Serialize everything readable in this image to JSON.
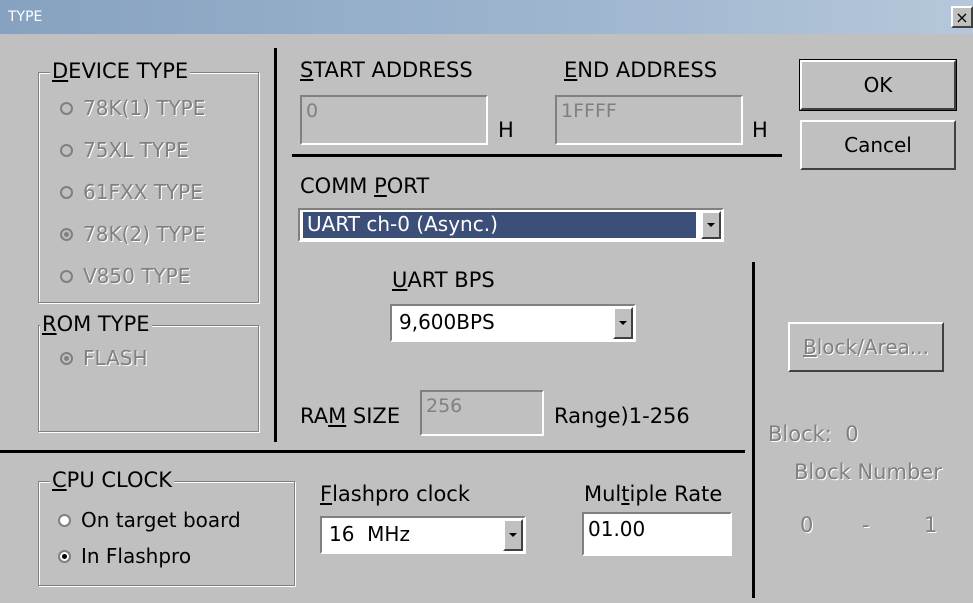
{
  "window": {
    "title": "TYPE",
    "close_glyph": "×"
  },
  "device_type": {
    "label_hotkey": "D",
    "label_rest": "EVICE TYPE",
    "options": [
      {
        "label": "78K(1) TYPE",
        "selected": false
      },
      {
        "label": "75XL TYPE",
        "selected": false
      },
      {
        "label": "61FXX TYPE",
        "selected": false
      },
      {
        "label": "78K(2) TYPE",
        "selected": true
      },
      {
        "label": "V850 TYPE",
        "selected": false
      }
    ]
  },
  "rom_type": {
    "label_hotkey": "R",
    "label_rest": "OM TYPE",
    "options": [
      {
        "label": "FLASH",
        "selected": true
      }
    ]
  },
  "start_address": {
    "label_hotkey": "S",
    "label_rest": "TART ADDRESS",
    "value": "0",
    "suffix": "H"
  },
  "end_address": {
    "label_hotkey": "E",
    "label_rest": "ND ADDRESS",
    "value": "1FFFF",
    "suffix": "H"
  },
  "buttons": {
    "ok": "OK",
    "cancel": "Cancel",
    "block_area_hotkey": "B",
    "block_area_rest": "lock/Area..."
  },
  "comm_port": {
    "label_pre": "COMM ",
    "label_hotkey": "P",
    "label_rest": "ORT",
    "value": "UART ch-0 (Async.)"
  },
  "uart_bps": {
    "label_hotkey": "U",
    "label_rest": "ART BPS",
    "value": "9,600BPS"
  },
  "ram_size": {
    "label_pre": "RA",
    "label_hotkey": "M",
    "label_rest": " SIZE",
    "value": "256",
    "range": "Range)1-256"
  },
  "block": {
    "label": "Block:",
    "value": "0",
    "number_label": "Block Number",
    "from": "0",
    "dash": "-",
    "to": "1"
  },
  "cpu_clock": {
    "label_hotkey": "C",
    "label_rest": "PU CLOCK",
    "options": [
      {
        "label": "On target board",
        "selected": false
      },
      {
        "label": "In Flashpro",
        "selected": true
      }
    ]
  },
  "flashpro_clock": {
    "label_hotkey": "F",
    "label_rest": "lashpro clock",
    "value": "16  MHz"
  },
  "multiple_rate": {
    "label_pre": "Mul",
    "label_hotkey": "t",
    "label_rest": "iple Rate",
    "value": "01.00"
  }
}
